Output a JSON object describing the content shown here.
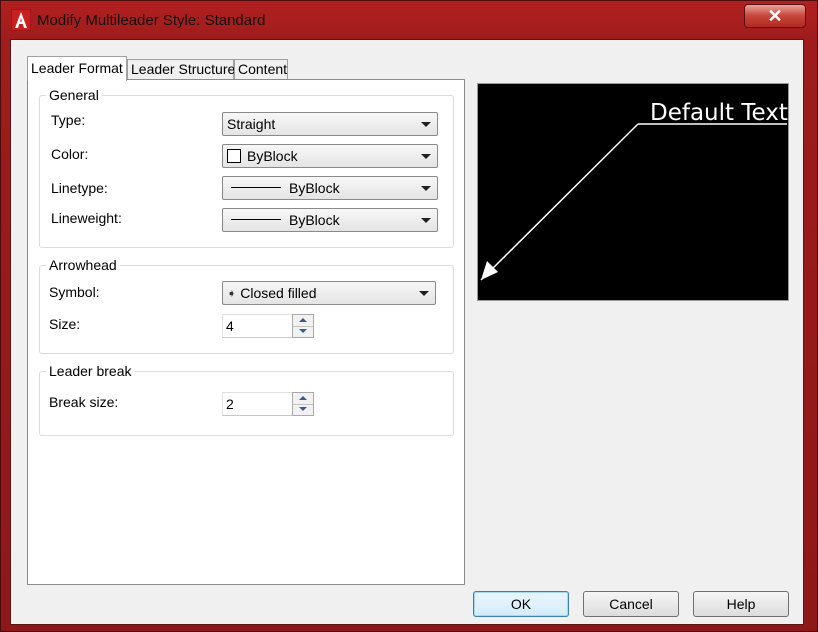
{
  "window": {
    "title": "Modify Multileader Style: Standard",
    "close_label": "✕"
  },
  "tabs": [
    {
      "label": "Leader Format"
    },
    {
      "label": "Leader Structure"
    },
    {
      "label": "Content"
    }
  ],
  "general": {
    "title": "General",
    "type_label": "Type:",
    "type_value": "Straight",
    "color_label": "Color:",
    "color_value": "ByBlock",
    "linetype_label": "Linetype:",
    "linetype_value": "ByBlock",
    "lineweight_label": "Lineweight:",
    "lineweight_value": "ByBlock"
  },
  "arrowhead": {
    "title": "Arrowhead",
    "symbol_label": "Symbol:",
    "symbol_value": "Closed filled",
    "size_label": "Size:",
    "size_value": "4"
  },
  "leader_break": {
    "title": "Leader break",
    "break_size_label": "Break size:",
    "break_size_value": "2"
  },
  "preview": {
    "text": "Default Text"
  },
  "buttons": {
    "ok": "OK",
    "cancel": "Cancel",
    "help": "Help"
  }
}
